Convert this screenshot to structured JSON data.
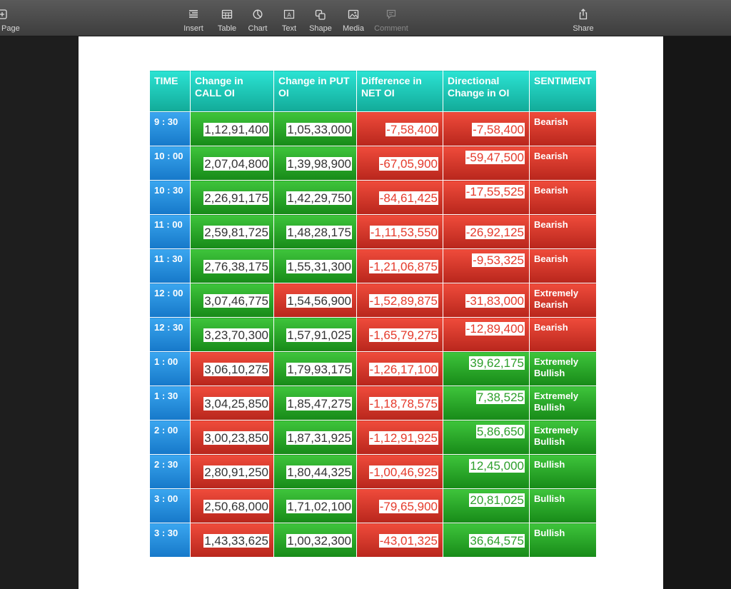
{
  "toolbar": {
    "page_label": "Page",
    "items": [
      {
        "label": "Insert",
        "icon": "insert-icon"
      },
      {
        "label": "Table",
        "icon": "table-icon"
      },
      {
        "label": "Chart",
        "icon": "chart-icon"
      },
      {
        "label": "Text",
        "icon": "text-icon"
      },
      {
        "label": "Shape",
        "icon": "shape-icon"
      },
      {
        "label": "Media",
        "icon": "media-icon"
      },
      {
        "label": "Comment",
        "icon": "comment-icon"
      }
    ],
    "share_label": "Share"
  },
  "colors": {
    "header": "#12aa98",
    "time": "#1678c9",
    "green": "#2fb52d",
    "red": "#d9362a"
  },
  "table": {
    "headers": [
      "TIME",
      "Change in CALL OI",
      "Change in PUT OI",
      "Difference in NET OI",
      "Directional Change in OI",
      "SENTIMENT"
    ],
    "rows": [
      {
        "time": "9 : 30",
        "call": "1,12,91,400",
        "put": "1,05,33,000",
        "net": "-7,58,400",
        "dir": "-7,58,400",
        "sentiment": "Bearish",
        "call_bg": "green",
        "put_bg": "green",
        "net_bg": "red",
        "dir_bg": "red",
        "sent_bg": "red",
        "dir_pos": "mid"
      },
      {
        "time": "10 : 00",
        "call": "2,07,04,800",
        "put": "1,39,98,900",
        "net": "-67,05,900",
        "dir": "-59,47,500",
        "sentiment": "Bearish",
        "call_bg": "green",
        "put_bg": "green",
        "net_bg": "red",
        "dir_bg": "red",
        "sent_bg": "red",
        "dir_pos": "top"
      },
      {
        "time": "10 : 30",
        "call": "2,26,91,175",
        "put": "1,42,29,750",
        "net": "-84,61,425",
        "dir": "-17,55,525",
        "sentiment": "Bearish",
        "call_bg": "green",
        "put_bg": "green",
        "net_bg": "red",
        "dir_bg": "red",
        "sent_bg": "red",
        "dir_pos": "top"
      },
      {
        "time": "11 : 00",
        "call": "2,59,81,725",
        "put": "1,48,28,175",
        "net": "-1,11,53,550",
        "dir": "-26,92,125",
        "sentiment": "Bearish",
        "call_bg": "green",
        "put_bg": "green",
        "net_bg": "red",
        "dir_bg": "red",
        "sent_bg": "red",
        "dir_pos": "mid"
      },
      {
        "time": "11 : 30",
        "call": "2,76,38,175",
        "put": "1,55,31,300",
        "net": "-1,21,06,875",
        "dir": "-9,53,325",
        "sentiment": "Bearish",
        "call_bg": "green",
        "put_bg": "green",
        "net_bg": "red",
        "dir_bg": "red",
        "sent_bg": "red",
        "dir_pos": "top"
      },
      {
        "time": "12 : 00",
        "call": "3,07,46,775",
        "put": "1,54,56,900",
        "net": "-1,52,89,875",
        "dir": "-31,83,000",
        "sentiment": "Extremely Bearish",
        "call_bg": "green",
        "put_bg": "red",
        "net_bg": "red",
        "dir_bg": "red",
        "sent_bg": "red",
        "dir_pos": "mid"
      },
      {
        "time": "12 : 30",
        "call": "3,23,70,300",
        "put": "1,57,91,025",
        "net": "-1,65,79,275",
        "dir": "-12,89,400",
        "sentiment": "Bearish",
        "call_bg": "green",
        "put_bg": "green",
        "net_bg": "red",
        "dir_bg": "red",
        "sent_bg": "red",
        "dir_pos": "top"
      },
      {
        "time": "1 : 00",
        "call": "3,06,10,275",
        "put": "1,79,93,175",
        "net": "-1,26,17,100",
        "dir": "39,62,175",
        "sentiment": "Extremely Bullish",
        "call_bg": "red",
        "put_bg": "green",
        "net_bg": "red",
        "dir_bg": "green",
        "sent_bg": "green",
        "dir_pos": "top"
      },
      {
        "time": "1 : 30",
        "call": "3,04,25,850",
        "put": "1,85,47,275",
        "net": "-1,18,78,575",
        "dir": "7,38,525",
        "sentiment": "Extremely Bullish",
        "call_bg": "red",
        "put_bg": "green",
        "net_bg": "red",
        "dir_bg": "green",
        "sent_bg": "green",
        "dir_pos": "top"
      },
      {
        "time": "2 : 00",
        "call": "3,00,23,850",
        "put": "1,87,31,925",
        "net": "-1,12,91,925",
        "dir": "5,86,650",
        "sentiment": "Extremely Bullish",
        "call_bg": "red",
        "put_bg": "green",
        "net_bg": "red",
        "dir_bg": "green",
        "sent_bg": "green",
        "dir_pos": "top"
      },
      {
        "time": "2 : 30",
        "call": "2,80,91,250",
        "put": "1,80,44,325",
        "net": "-1,00,46,925",
        "dir": "12,45,000",
        "sentiment": "Bullish",
        "call_bg": "red",
        "put_bg": "green",
        "net_bg": "red",
        "dir_bg": "green",
        "sent_bg": "green",
        "dir_pos": "top"
      },
      {
        "time": "3 : 00",
        "call": "2,50,68,000",
        "put": "1,71,02,100",
        "net": "-79,65,900",
        "dir": "20,81,025",
        "sentiment": "Bullish",
        "call_bg": "red",
        "put_bg": "green",
        "net_bg": "red",
        "dir_bg": "green",
        "sent_bg": "green",
        "dir_pos": "top"
      },
      {
        "time": "3 : 30",
        "call": "1,43,33,625",
        "put": "1,00,32,300",
        "net": "-43,01,325",
        "dir": "36,64,575",
        "sentiment": "Bullish",
        "call_bg": "red",
        "put_bg": "green",
        "net_bg": "red",
        "dir_bg": "green",
        "sent_bg": "green",
        "dir_pos": "mid"
      }
    ]
  }
}
